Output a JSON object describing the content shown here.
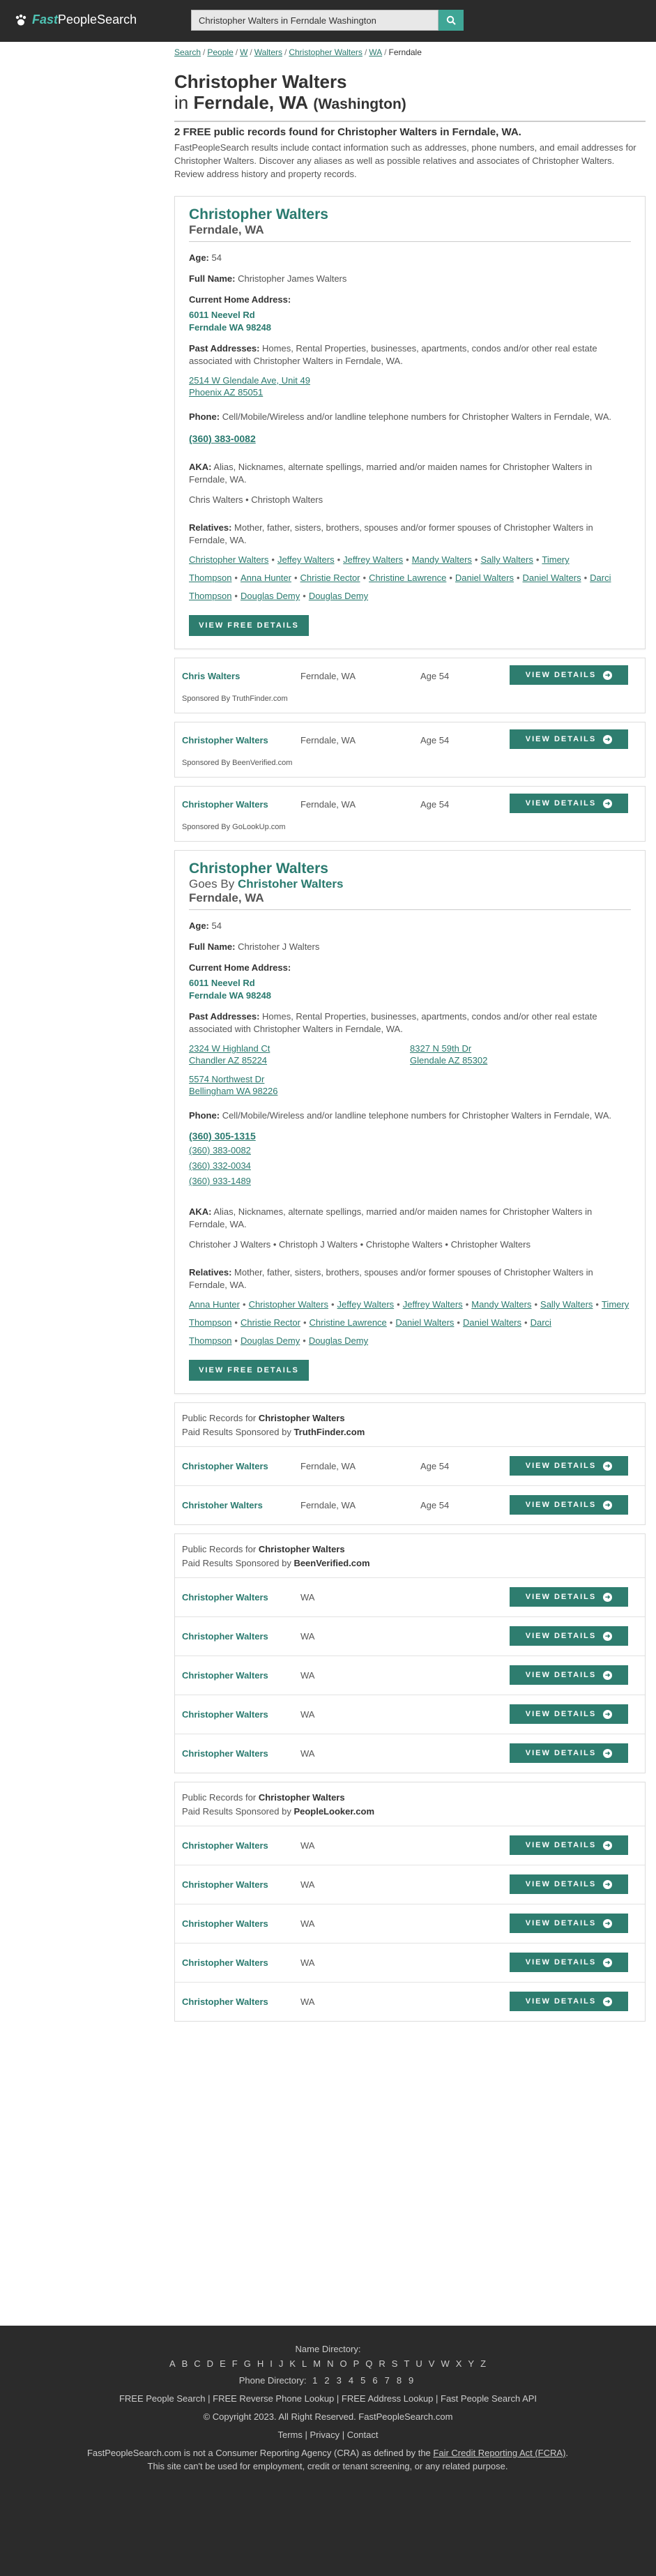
{
  "header": {
    "logo_fast": "Fast",
    "logo_people": "PeopleSearch",
    "search_value": "Christopher Walters in Ferndale Washington"
  },
  "breadcrumb": [
    "Search",
    "People",
    "W",
    "Walters",
    "Christopher Walters",
    "WA",
    "Ferndale"
  ],
  "title": {
    "name": "Christopher Walters",
    "in": "in",
    "city": "Ferndale, WA",
    "state": "(Washington)",
    "subhead": "2 FREE public records found for Christopher Walters in Ferndale, WA.",
    "intro": "FastPeopleSearch results include contact information such as addresses, phone numbers, and email addresses for Christopher Walters. Discover any aliases as well as possible relatives and associates of Christopher Walters. Review address history and property records."
  },
  "record1": {
    "name": "Christopher Walters",
    "location": "Ferndale, WA",
    "age_label": "Age:",
    "age": "54",
    "fullname_label": "Full Name:",
    "fullname": "Christopher James Walters",
    "current_label": "Current Home Address:",
    "current_line1": "6011 Neevel Rd",
    "current_line2": "Ferndale WA 98248",
    "past_label": "Past Addresses:",
    "past_desc": "Homes, Rental Properties, businesses, apartments, condos and/or other real estate associated with Christopher Walters in Ferndale, WA.",
    "past": [
      {
        "l1": "2514 W Glendale Ave, Unit 49",
        "l2": "Phoenix AZ 85051"
      }
    ],
    "phone_label": "Phone:",
    "phone_desc": "Cell/Mobile/Wireless and/or landline telephone numbers for Christopher Walters in Ferndale, WA.",
    "phone_main": "(360) 383-0082",
    "aka_label": "AKA:",
    "aka_desc": "Alias, Nicknames, alternate spellings, married and/or maiden names for Christopher Walters in Ferndale, WA.",
    "aka": "Chris Walters • Christoph Walters",
    "rel_label": "Relatives:",
    "rel_desc": "Mother, father, sisters, brothers, spouses and/or former spouses of Christopher Walters in Ferndale, WA.",
    "relatives": [
      "Christopher Walters",
      "Jeffey Walters",
      "Jeffrey Walters",
      "Mandy Walters",
      "Sally Walters",
      "Timery Thompson",
      "Anna Hunter",
      "Christie Rector",
      "Christine Lawrence",
      "Daniel Walters",
      "Daniel Walters",
      "Darci Thompson",
      "Douglas Demy",
      "Douglas Demy"
    ],
    "button": "VIEW FREE DETAILS"
  },
  "sponsored": [
    {
      "name": "Chris Walters",
      "loc": "Ferndale, WA",
      "age": "Age 54",
      "by": "Sponsored By TruthFinder.com",
      "button": "VIEW DETAILS"
    },
    {
      "name": "Christopher Walters",
      "loc": "Ferndale, WA",
      "age": "Age 54",
      "by": "Sponsored By BeenVerified.com",
      "button": "VIEW DETAILS"
    },
    {
      "name": "Christopher Walters",
      "loc": "Ferndale, WA",
      "age": "Age 54",
      "by": "Sponsored By GoLookUp.com",
      "button": "VIEW DETAILS"
    }
  ],
  "record2": {
    "name": "Christopher Walters",
    "goes_by": "Goes By",
    "goes_by_name": "Christoher Walters",
    "location": "Ferndale, WA",
    "age_label": "Age:",
    "age": "54",
    "fullname_label": "Full Name:",
    "fullname": "Christoher J Walters",
    "current_label": "Current Home Address:",
    "current_line1": "6011 Neevel Rd",
    "current_line2": "Ferndale WA 98248",
    "past_label": "Past Addresses:",
    "past_desc": "Homes, Rental Properties, businesses, apartments, condos and/or other real estate associated with Christopher Walters in Ferndale, WA.",
    "past": [
      {
        "l1": "2324 W Highland Ct",
        "l2": "Chandler AZ 85224"
      },
      {
        "l1": "8327 N 59th Dr",
        "l2": "Glendale AZ 85302"
      },
      {
        "l1": "5574 Northwest Dr",
        "l2": "Bellingham WA 98226"
      }
    ],
    "phone_label": "Phone:",
    "phone_desc": "Cell/Mobile/Wireless and/or landline telephone numbers for Christopher Walters in Ferndale, WA.",
    "phone_main": "(360) 305-1315",
    "phones": [
      "(360) 383-0082",
      "(360) 332-0034",
      "(360) 933-1489"
    ],
    "aka_label": "AKA:",
    "aka_desc": "Alias, Nicknames, alternate spellings, married and/or maiden names for Christopher Walters in Ferndale, WA.",
    "aka": "Christoher J Walters • Christoph J Walters • Christophe Walters • Christopher Walters",
    "rel_label": "Relatives:",
    "rel_desc": "Mother, father, sisters, brothers, spouses and/or former spouses of Christopher Walters in Ferndale, WA.",
    "relatives": [
      "Anna Hunter",
      "Christopher Walters",
      "Jeffey Walters",
      "Jeffrey Walters",
      "Mandy Walters",
      "Sally Walters",
      "Timery Thompson",
      "Christie Rector",
      "Christine Lawrence",
      "Daniel Walters",
      "Daniel Walters",
      "Darci Thompson",
      "Douglas Demy",
      "Douglas Demy"
    ],
    "button": "VIEW FREE DETAILS"
  },
  "paid_sections": [
    {
      "prefix": "Public Records for",
      "name": "Christopher Walters",
      "sponsor_prefix": "Paid Results Sponsored by",
      "sponsor": "TruthFinder.com",
      "rows": [
        {
          "name": "Christopher Walters",
          "loc": "Ferndale, WA",
          "age": "Age 54"
        },
        {
          "name": "Christoher Walters",
          "loc": "Ferndale, WA",
          "age": "Age 54"
        }
      ]
    },
    {
      "prefix": "Public Records for",
      "name": "Christopher Walters",
      "sponsor_prefix": "Paid Results Sponsored by",
      "sponsor": "BeenVerified.com",
      "rows": [
        {
          "name": "Christopher Walters",
          "loc": "WA",
          "age": ""
        },
        {
          "name": "Christopher Walters",
          "loc": "WA",
          "age": ""
        },
        {
          "name": "Christopher Walters",
          "loc": "WA",
          "age": ""
        },
        {
          "name": "Christopher Walters",
          "loc": "WA",
          "age": ""
        },
        {
          "name": "Christopher Walters",
          "loc": "WA",
          "age": ""
        }
      ]
    },
    {
      "prefix": "Public Records for",
      "name": "Christopher Walters",
      "sponsor_prefix": "Paid Results Sponsored by",
      "sponsor": "PeopleLooker.com",
      "rows": [
        {
          "name": "Christopher Walters",
          "loc": "WA",
          "age": ""
        },
        {
          "name": "Christopher Walters",
          "loc": "WA",
          "age": ""
        },
        {
          "name": "Christopher Walters",
          "loc": "WA",
          "age": ""
        },
        {
          "name": "Christopher Walters",
          "loc": "WA",
          "age": ""
        },
        {
          "name": "Christopher Walters",
          "loc": "WA",
          "age": ""
        }
      ]
    }
  ],
  "view_details": "VIEW DETAILS",
  "footer": {
    "name_directory": "Name Directory:",
    "letters": [
      "A",
      "B",
      "C",
      "D",
      "E",
      "F",
      "G",
      "H",
      "I",
      "J",
      "K",
      "L",
      "M",
      "N",
      "O",
      "P",
      "Q",
      "R",
      "S",
      "T",
      "U",
      "V",
      "W",
      "X",
      "Y",
      "Z"
    ],
    "phone_directory": "Phone Directory:",
    "digits": [
      "1",
      "2",
      "3",
      "4",
      "5",
      "6",
      "7",
      "8",
      "9"
    ],
    "links": "FREE People Search | FREE Reverse Phone Lookup | FREE Address Lookup | Fast People Search API",
    "copyright": "© Copyright 2023. All Right Reserved. FastPeopleSearch.com",
    "legal": "Terms | Privacy | Contact",
    "disclaimer_a": "FastPeopleSearch.com is not a Consumer Reporting Agency (CRA) as defined by the",
    "disclaimer_link": "Fair Credit Reporting Act (FCRA)",
    "disclaimer_b": ". This site can't be used for employment, credit or tenant screening, or any related purpose."
  }
}
